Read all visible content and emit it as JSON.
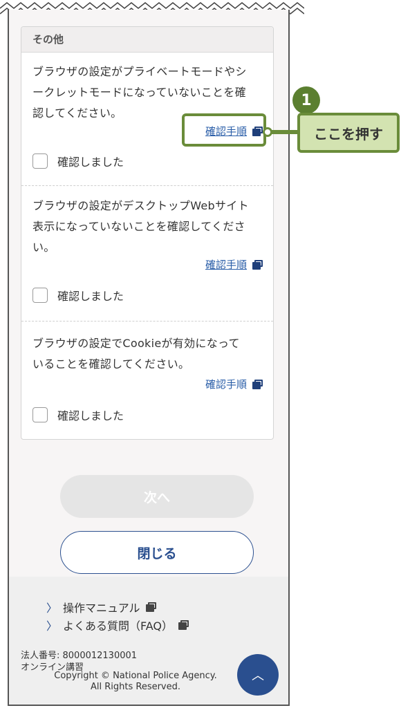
{
  "card": {
    "title": "その他",
    "items": [
      {
        "desc_lines": [
          "ブラウザの設定がプライベートモードやシ",
          "ークレットモードになっていないことを確",
          "認してください。"
        ],
        "link": "確認手順",
        "check_label": "確認しました"
      },
      {
        "desc_lines": [
          "ブラウザの設定がデスクトップWebサイト",
          "表示になっていないことを確認してくださ",
          "い。"
        ],
        "link": "確認手順",
        "check_label": "確認しました"
      },
      {
        "desc_lines": [
          "ブラウザの設定でCookieが有効になって",
          "いることを確認してください。"
        ],
        "link": "確認手順",
        "check_label": "確認しました"
      }
    ]
  },
  "buttons": {
    "next": "次へ",
    "close": "閉じる"
  },
  "footer": {
    "links": [
      "操作マニュアル",
      "よくある質問（FAQ）"
    ],
    "corp_number": "法人番号: 8000012130001",
    "service": "オンライン講習",
    "copyright_line1": "Copyright © National Police Agency.",
    "copyright_line2": "All Rights Reserved.",
    "to_top_icon": "chevron-up-icon"
  },
  "annotation": {
    "number": "1",
    "label": "ここを押す",
    "color": "#6a8c3a",
    "fill": "#d3e3b1"
  },
  "colors": {
    "accent": "#2a4f8f",
    "link": "#2a5ea8",
    "disabled": "#e5e5e5"
  }
}
